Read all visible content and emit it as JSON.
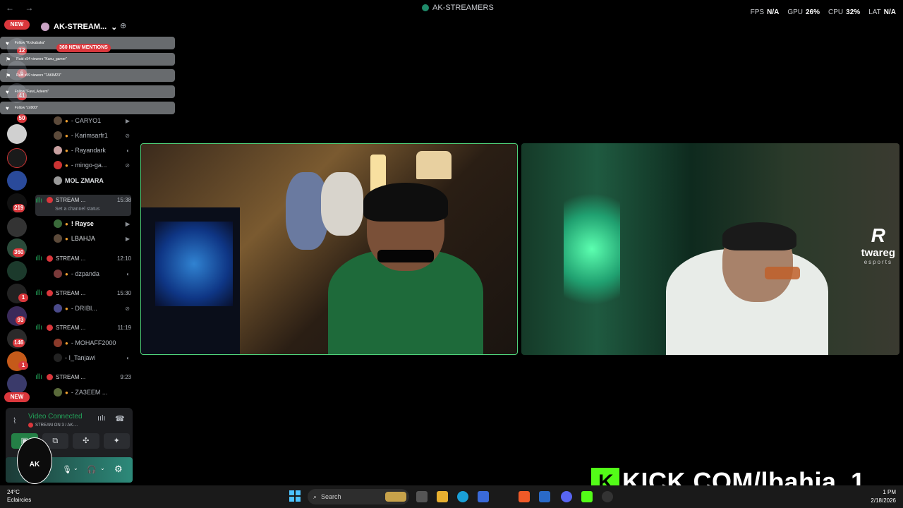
{
  "titlebar": {
    "nav": "← →",
    "title": "AK-STREAMERS",
    "stats": [
      {
        "label": "FPS",
        "value": "N/A"
      },
      {
        "label": "GPU",
        "value": "26%"
      },
      {
        "label": "CPU",
        "value": "32%"
      },
      {
        "label": "LAT",
        "value": "N/A"
      }
    ]
  },
  "rail": {
    "new_top": "NEW",
    "new_bottom": "NEW",
    "badges": [
      "12",
      "6",
      "41",
      "50",
      "219",
      "360",
      "1",
      "93",
      "146",
      "1"
    ]
  },
  "server": {
    "name": "AK-STREAM...",
    "mentions": "360 NEW MENTIONS"
  },
  "toasts": [
    "Follow \"Krokabaka\"",
    "Raid x54 viewers \"Kanu_gamer\"",
    "Raid x59 viewers \"7AKIM23\"",
    "Follow \"Fawi_Adeem\"",
    "Follow \"zri900\""
  ],
  "channels": {
    "top_users": [
      "- CARYO1",
      "- Karimsarfr1",
      "- Rayandark",
      "- mingo-ga...",
      "MOL ZMARA"
    ],
    "stream_1": {
      "label": "STREAM ...",
      "time": "15:38",
      "status": "Set a channel status",
      "users": [
        "! Rayse",
        "LBAHJA"
      ]
    },
    "stream_2": {
      "label": "STREAM ...",
      "time": "12:10",
      "users": [
        "- dzpanda"
      ]
    },
    "stream_3": {
      "label": "STREAM ...",
      "time": "15:30",
      "users": [
        "- DRIBI..."
      ]
    },
    "stream_4": {
      "label": "STREAM ...",
      "time": "11:19",
      "users": [
        "- MOHAFF2000",
        "- I_Tanjawi"
      ]
    },
    "stream_5": {
      "label": "STREAM ...",
      "time": "9:23",
      "users": [
        "- ZA3EEM ..."
      ]
    }
  },
  "voice": {
    "status": "Video Connected",
    "sub": "STREAM ON 3 / AK-..."
  },
  "overlay": {
    "brand": "twareg",
    "brand_sub": "esports",
    "kick": "KICK.COM/lbahja_1"
  },
  "taskbar": {
    "temp": "24°C",
    "weather": "Eclaircies",
    "search": "Search",
    "time": "1 PM",
    "date": "2/18/2026"
  }
}
